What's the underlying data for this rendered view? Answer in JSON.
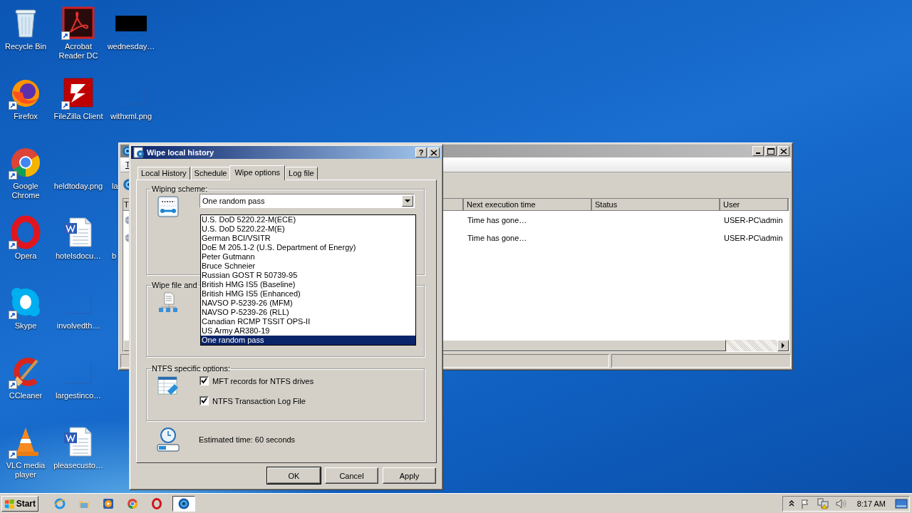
{
  "desktop": {
    "icons": [
      {
        "label": "Recycle Bin",
        "kind": "recycle",
        "shortcut": false
      },
      {
        "label": "Firefox",
        "kind": "firefox",
        "shortcut": true
      },
      {
        "label": "Google Chrome",
        "kind": "chrome",
        "shortcut": true
      },
      {
        "label": "Opera",
        "kind": "opera",
        "shortcut": true
      },
      {
        "label": "Skype",
        "kind": "skype",
        "shortcut": true
      },
      {
        "label": "CCleaner",
        "kind": "ccleaner",
        "shortcut": true
      },
      {
        "label": "VLC media player",
        "kind": "vlc",
        "shortcut": true
      },
      {
        "label": "Acrobat Reader DC",
        "kind": "acrobat",
        "shortcut": true
      },
      {
        "label": "FileZilla Client",
        "kind": "filezilla",
        "shortcut": true
      },
      {
        "label": "heldtoday.png",
        "kind": "blank-image",
        "shortcut": false
      },
      {
        "label": "hotelsdocu…",
        "kind": "word",
        "shortcut": false
      },
      {
        "label": "involvedth…",
        "kind": "blank-image",
        "shortcut": false
      },
      {
        "label": "largestinco…",
        "kind": "blank-image",
        "shortcut": false
      },
      {
        "label": "pleasecusto…",
        "kind": "word",
        "shortcut": false
      },
      {
        "label": "wednesday…",
        "kind": "dark-image",
        "shortcut": false
      },
      {
        "label": "withxml.png",
        "kind": "blank-image",
        "shortcut": false
      },
      {
        "label": "la",
        "kind": "covered",
        "shortcut": false
      },
      {
        "label": "b",
        "kind": "covered",
        "shortcut": false
      }
    ]
  },
  "background_window": {
    "menu": [
      {
        "label": "T"
      }
    ],
    "columns": [
      "T",
      "Next execution time",
      "Status",
      "User"
    ],
    "rows": [
      {
        "next_execution_time": "Time has gone…",
        "user": "USER-PC\\admin"
      },
      {
        "next_execution_time": "Time has gone…",
        "user": "USER-PC\\admin"
      }
    ]
  },
  "dialog": {
    "title": "Wipe local history",
    "help_button": "?",
    "tabs": [
      {
        "label": "Local History",
        "selected": false
      },
      {
        "label": "Schedule",
        "selected": false
      },
      {
        "label": "Wipe options",
        "selected": true
      },
      {
        "label": "Log file",
        "selected": false
      }
    ],
    "wiping_scheme": {
      "label": "Wiping scheme:",
      "value": "One random pass",
      "expanded": true,
      "options": [
        {
          "label": "U.S. DoD 5220.22-M(ECE)",
          "selected": false
        },
        {
          "label": "U.S. DoD 5220.22-M(E)",
          "selected": false
        },
        {
          "label": "German BCI/VSITR",
          "selected": false
        },
        {
          "label": "DoE M 205.1-2 (U.S. Department of Energy)",
          "selected": false
        },
        {
          "label": "Peter Gutmann",
          "selected": false
        },
        {
          "label": "Bruce Schneier",
          "selected": false
        },
        {
          "label": "Russian GOST R 50739-95",
          "selected": false
        },
        {
          "label": "British HMG IS5 (Baseline)",
          "selected": false
        },
        {
          "label": "British HMG IS5 (Enhanced)",
          "selected": false
        },
        {
          "label": "NAVSO P-5239-26 (MFM)",
          "selected": false
        },
        {
          "label": "NAVSO P-5239-26 (RLL)",
          "selected": false
        },
        {
          "label": "Canadian RCMP TSSIT OPS-II",
          "selected": false
        },
        {
          "label": "US Army AR380-19",
          "selected": false
        },
        {
          "label": "One random pass",
          "selected": true
        }
      ]
    },
    "wipe_file_group": {
      "label": "Wipe file and"
    },
    "ntfs_options": {
      "label": "NTFS specific options:",
      "checkboxes": [
        {
          "label": "MFT records for NTFS drives",
          "checked": true
        },
        {
          "label": "NTFS Transaction Log File",
          "checked": true
        }
      ]
    },
    "estimated_time": "Estimated time: 60 seconds",
    "buttons": [
      {
        "label": "OK",
        "default": true
      },
      {
        "label": "Cancel",
        "default": false
      },
      {
        "label": "Apply",
        "default": false
      }
    ]
  },
  "taskbar": {
    "start": "Start",
    "quick_launch": [
      {
        "kind": "ie"
      },
      {
        "kind": "folder"
      },
      {
        "kind": "media"
      },
      {
        "kind": "chrome"
      },
      {
        "kind": "opera"
      }
    ],
    "tasks": [
      {
        "kind": "gear-globe",
        "selected": true
      }
    ],
    "clock": "8:17 AM"
  }
}
